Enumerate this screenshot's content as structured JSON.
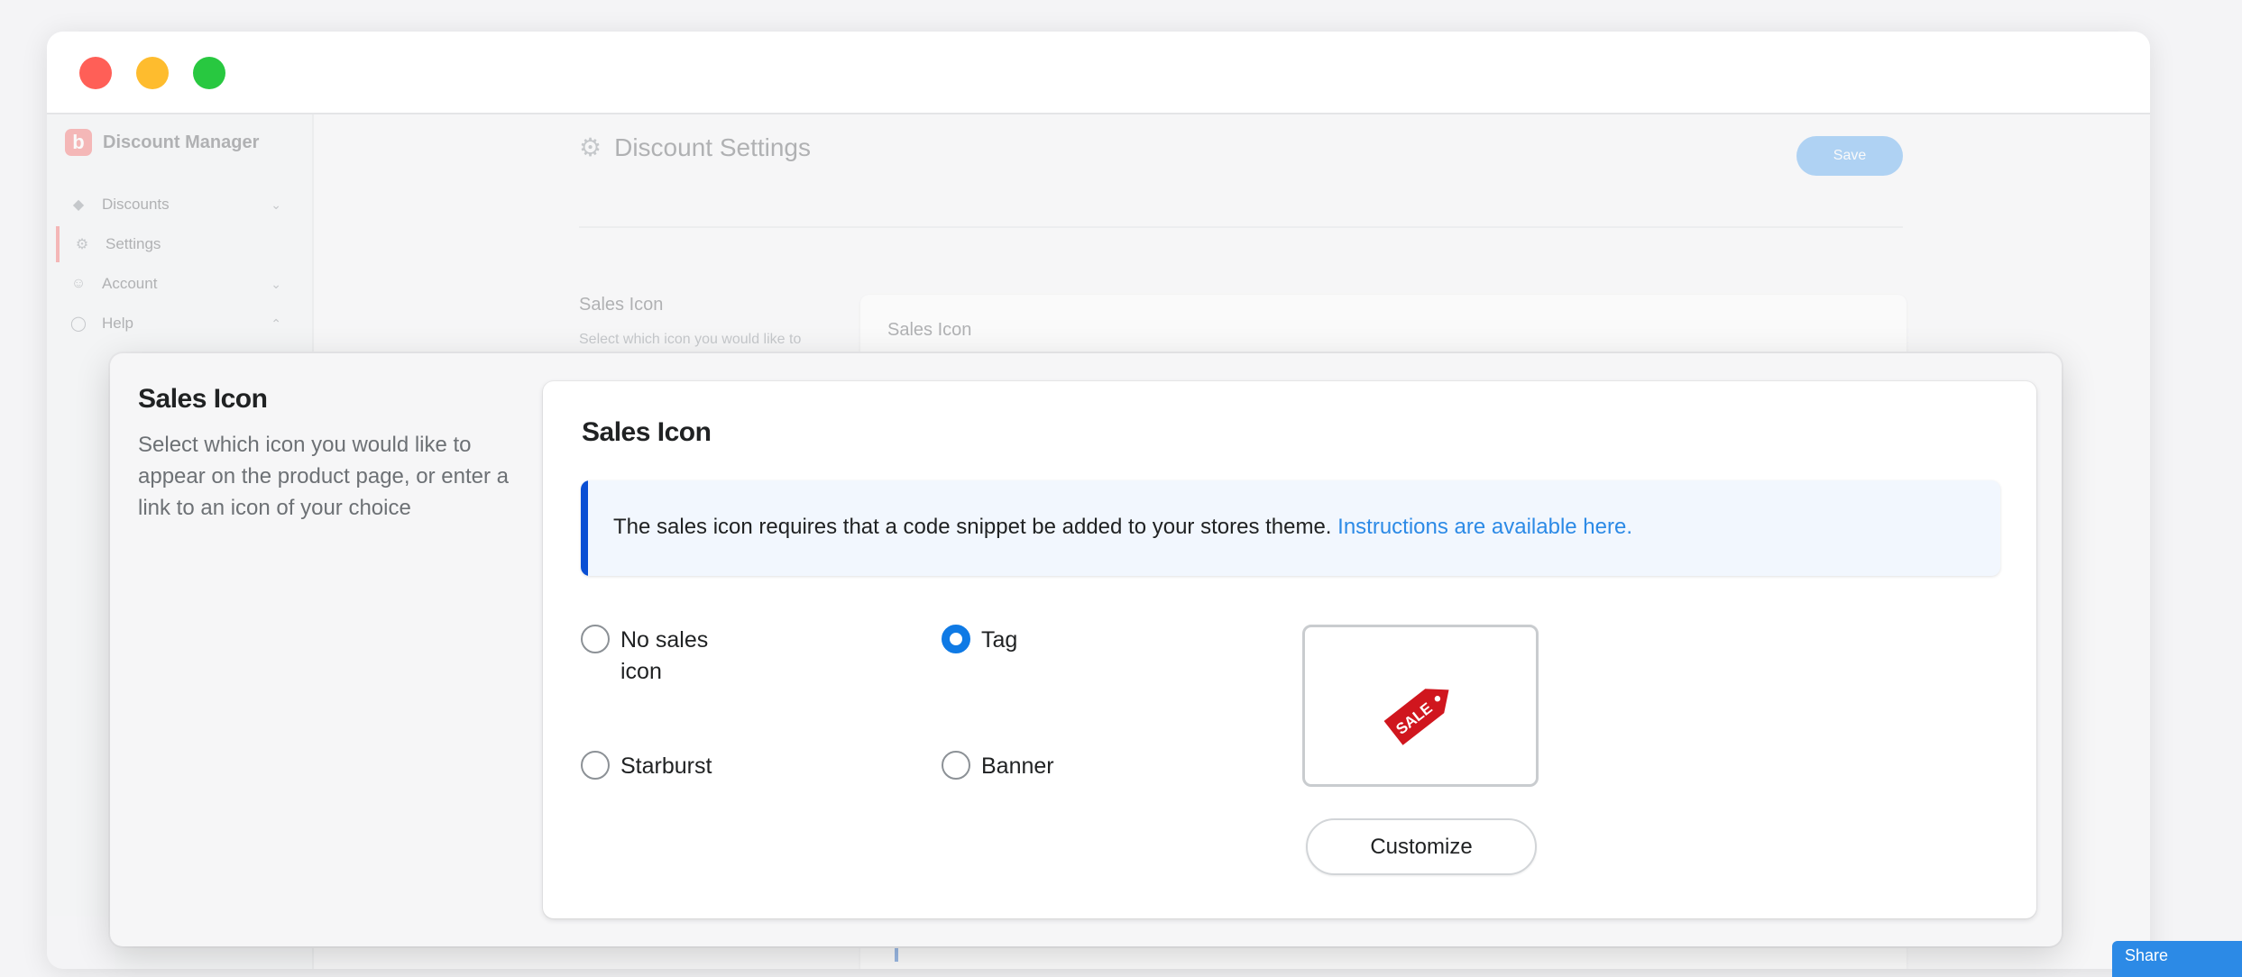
{
  "window": {
    "controls": [
      "close",
      "minimize",
      "maximize"
    ]
  },
  "sidebar": {
    "brand": {
      "logo_letter": "b",
      "name": "Discount Manager"
    },
    "items": [
      {
        "label": "Discounts",
        "icon": "tag-icon",
        "chevron": "down"
      },
      {
        "label": "Settings",
        "icon": "gear-icon",
        "active": true
      },
      {
        "label": "Account",
        "icon": "user-icon",
        "chevron": "down"
      },
      {
        "label": "Help",
        "icon": "help-icon",
        "chevron": "up"
      }
    ]
  },
  "page": {
    "title": "Discount Settings",
    "save_label": "Save",
    "section_title": "Sales Icon",
    "section_desc": "Select which icon you would like to appear on the product page, or enter a link to an icon of your choice",
    "card_title": "Sales Icon"
  },
  "sales_icon": {
    "title": "Sales Icon",
    "description": "Select which icon you would like to appear on the product page, or enter a link to an icon of your choice",
    "card_title": "Sales Icon",
    "banner": {
      "text": "The sales icon requires that a code snippet be added to your stores theme. ",
      "link": "Instructions are available here."
    },
    "options": [
      {
        "label": "No sales icon",
        "checked": false
      },
      {
        "label": "Tag",
        "checked": true
      },
      {
        "label": "Starburst",
        "checked": false
      },
      {
        "label": "Banner",
        "checked": false
      }
    ],
    "preview": {
      "icon": "sale-tag-icon",
      "badge_text": "SALE"
    },
    "customize_label": "Customize"
  },
  "share_label": "Share",
  "colors": {
    "accent": "#0f7ae5",
    "link": "#2c8ae6",
    "banner_bar": "#0a4fd4",
    "brand": "#f26b6b",
    "sale_red": "#d0161e"
  }
}
